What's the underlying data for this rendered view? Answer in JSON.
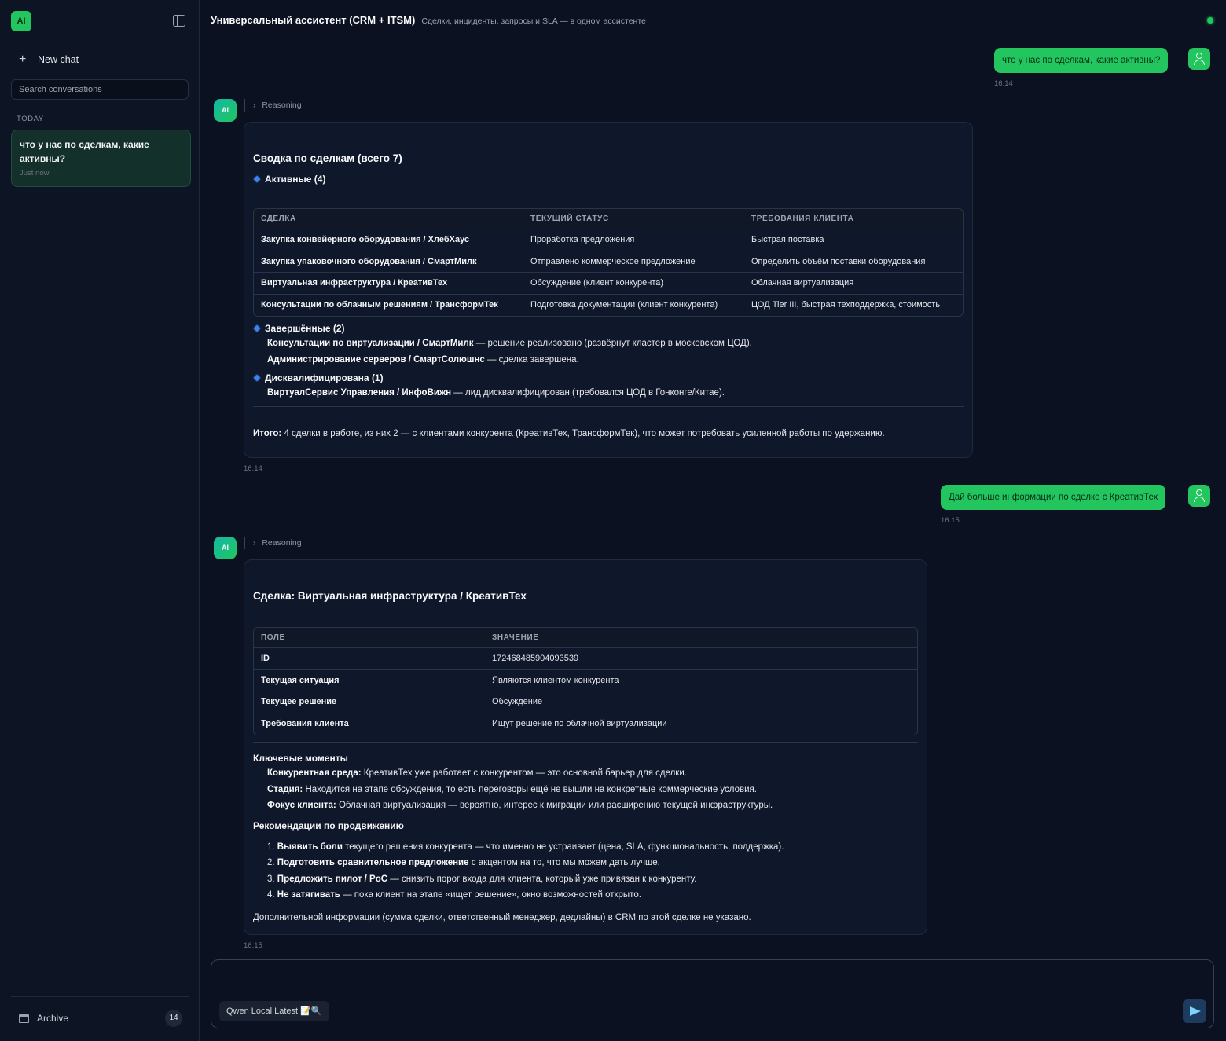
{
  "sidebar": {
    "logo": "AI",
    "new_chat": "New chat",
    "search_placeholder": "Search conversations",
    "section_today": "TODAY",
    "conversation": {
      "title": "что у нас по сделкам, какие активны?",
      "time": "Just now"
    },
    "archive_label": "Archive",
    "archive_count": "14"
  },
  "header": {
    "title": "Универсальный ассистент (CRM + ITSM)",
    "subtitle": "Сделки, инциденты, запросы и SLA — в одном ассистенте"
  },
  "messages": {
    "user1": {
      "text": "что у нас по сделкам, какие активны?",
      "time": "16:14"
    },
    "ai1": {
      "avatar": "AI",
      "reasoning": "Reasoning",
      "title": "Сводка по сделкам (всего 7)",
      "active_heading": "Активные (4)",
      "table_headers": [
        "СДЕЛКА",
        "ТЕКУЩИЙ СТАТУС",
        "ТРЕБОВАНИЯ КЛИЕНТА"
      ],
      "rows": [
        [
          "Закупка конвейерного оборудования / ХлебХаус",
          "Проработка предложения",
          "Быстрая поставка"
        ],
        [
          "Закупка упаковочного оборудования / СмартМилк",
          "Отправлено коммерческое предложение",
          "Определить объём поставки оборудования"
        ],
        [
          "Виртуальная инфраструктура / КреативТех",
          "Обсуждение (клиент конкурента)",
          "Облачная виртуализация"
        ],
        [
          "Консультации по облачным решениям / ТрансформТек",
          "Подготовка документации (клиент конкурента)",
          "ЦОД Tier III, быстрая техподдержка, стоимость"
        ]
      ],
      "completed_heading": "Завершённые (2)",
      "completed": [
        {
          "name": "Консультации по виртуализации / СмартМилк",
          "text": " — решение реализовано (развёрнут кластер в московском ЦОД)."
        },
        {
          "name": "Администрирование серверов / СмартСолюшнс",
          "text": " — сделка завершена."
        }
      ],
      "disq_heading": "Дисквалифицирована (1)",
      "disq": [
        {
          "name": "ВиртуалСервис Управления / ИнфоВижн",
          "text": " — лид дисквалифицирован (требовался ЦОД в Гонконге/Китае)."
        }
      ],
      "total_label": "Итого:",
      "total_text": " 4 сделки в работе, из них 2 — с клиентами конкурента (КреативТех, ТрансформТек), что может потребовать усиленной работы по удержанию.",
      "time": "16:14"
    },
    "user2": {
      "text": "Дай больше информации по сделке с КреативТех",
      "time": "16:15"
    },
    "ai2": {
      "avatar": "AI",
      "reasoning": "Reasoning",
      "title": "Сделка: Виртуальная инфраструктура / КреативТех",
      "table_headers": [
        "ПОЛЕ",
        "ЗНАЧЕНИЕ"
      ],
      "rows": [
        [
          "ID",
          "172468485904093539"
        ],
        [
          "Текущая ситуация",
          "Являются клиентом конкурента"
        ],
        [
          "Текущее решение",
          "Обсуждение"
        ],
        [
          "Требования клиента",
          "Ищут решение по облачной виртуализации"
        ]
      ],
      "key_heading": "Ключевые моменты",
      "key_points": [
        {
          "label": "Конкурентная среда:",
          "text": " КреативТех уже работает с конкурентом — это основной барьер для сделки."
        },
        {
          "label": "Стадия:",
          "text": " Находится на этапе обсуждения, то есть переговоры ещё не вышли на конкретные коммерческие условия."
        },
        {
          "label": "Фокус клиента:",
          "text": " Облачная виртуализация — вероятно, интерес к миграции или расширению текущей инфраструктуры."
        }
      ],
      "rec_heading": "Рекомендации по продвижению",
      "recs": [
        {
          "num": "1.",
          "label": "Выявить боли",
          "text": " текущего решения конкурента — что именно не устраивает (цена, SLA, функциональность, поддержка)."
        },
        {
          "num": "2.",
          "label": "Подготовить сравнительное предложение",
          "text": " с акцентом на то, что мы можем дать лучше."
        },
        {
          "num": "3.",
          "label": "Предложить пилот / PoC",
          "text": " — снизить порог входа для клиента, который уже привязан к конкуренту."
        },
        {
          "num": "4.",
          "label": "Не затягивать",
          "text": " — пока клиент на этапе «ищет решение», окно возможностей открыто."
        }
      ],
      "footer": "Дополнительной информации (сумма сделки, ответственный менеджер, дедлайны) в CRM по этой сделке не указано.",
      "time": "16:15"
    }
  },
  "composer": {
    "model": "Qwen Local Latest 📝🔍"
  },
  "colors": {
    "accent": "#22c55e",
    "background": "#0b1120",
    "card": "#0f172a",
    "diamond": "#3b82f6"
  }
}
